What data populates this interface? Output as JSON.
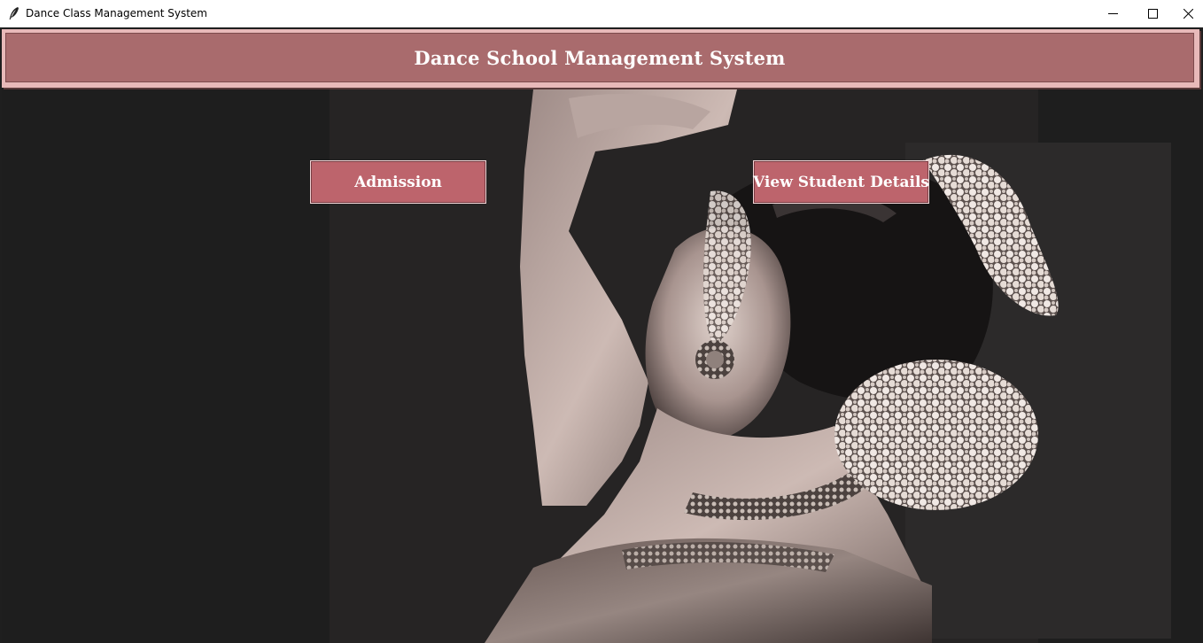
{
  "window": {
    "title": "Dance Class Management System",
    "icon": "feather-icon",
    "controls": [
      "minimize-icon",
      "maximize-icon",
      "close-icon"
    ]
  },
  "header": {
    "title": "Dance School Management System"
  },
  "buttons": {
    "admission": "Admission",
    "view_student_details": "View Student Details"
  },
  "colors": {
    "header_bg": "#a96b6d",
    "header_border": "#e8b9b9",
    "button_bg": "#bd646c",
    "background": "#1e1e1e"
  },
  "background_image": {
    "subject": "dancer-photo"
  }
}
